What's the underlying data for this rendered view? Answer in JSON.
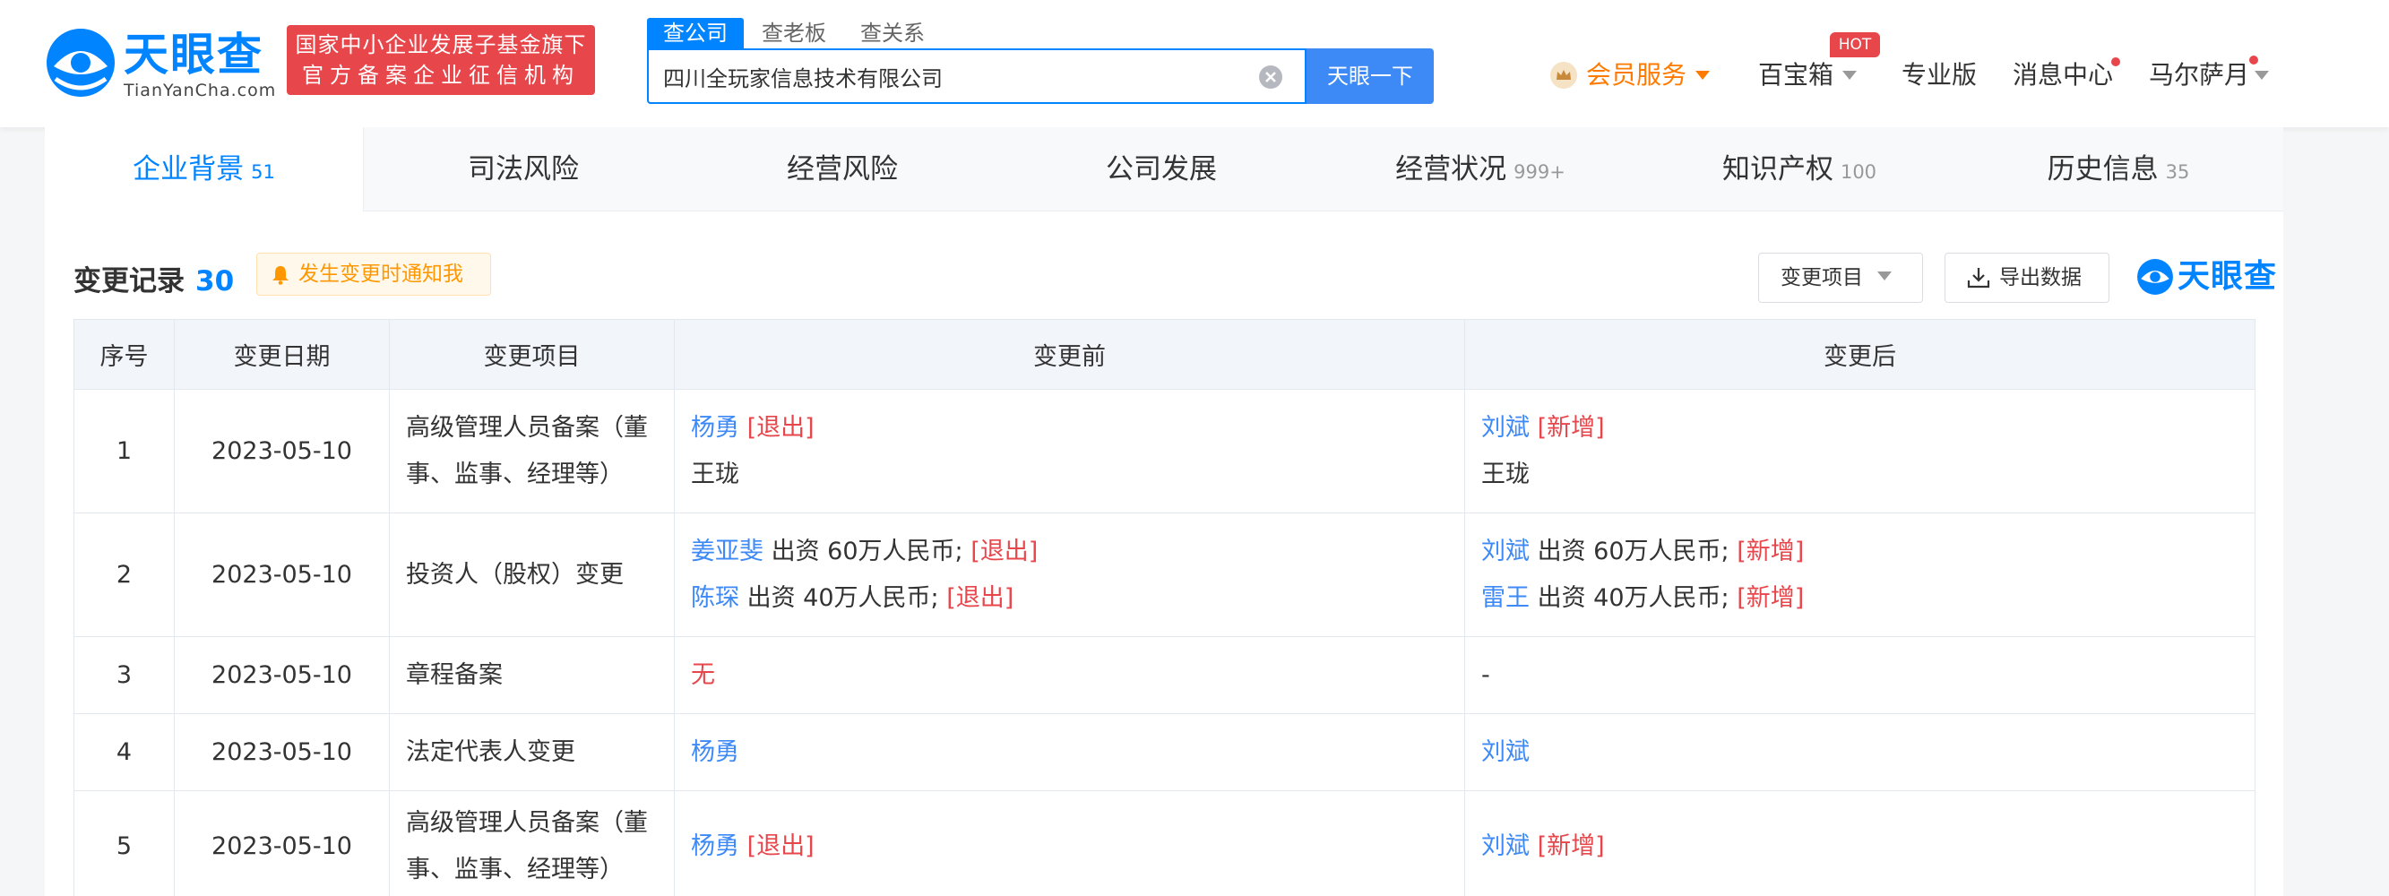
{
  "header": {
    "logo_text": "天眼查",
    "logo_sub": "TianYanCha.com",
    "badge_line1": "国家中小企业发展子基金旗下",
    "badge_line2": "官方备案企业征信机构",
    "search_tabs": [
      "查公司",
      "查老板",
      "查关系"
    ],
    "search_value": "四川全玩家信息技术有限公司",
    "search_button": "天眼一下",
    "nav": {
      "vip": "会员服务",
      "toolbox": "百宝箱",
      "hot": "HOT",
      "pro": "专业版",
      "messages": "消息中心",
      "user": "马尔萨月"
    }
  },
  "tabs": [
    {
      "label": "企业背景",
      "count": "51"
    },
    {
      "label": "司法风险",
      "count": ""
    },
    {
      "label": "经营风险",
      "count": ""
    },
    {
      "label": "公司发展",
      "count": ""
    },
    {
      "label": "经营状况",
      "count": "999+"
    },
    {
      "label": "知识产权",
      "count": "100"
    },
    {
      "label": "历史信息",
      "count": "35"
    }
  ],
  "section": {
    "title": "变更记录",
    "count": "30",
    "notify": "发生变更时通知我",
    "filter": "变更项目",
    "export": "导出数据",
    "mini_logo": "天眼查"
  },
  "table": {
    "headers": [
      "序号",
      "变更日期",
      "变更项目",
      "变更前",
      "变更后"
    ],
    "rows": [
      {
        "idx": "1",
        "date": "2023-05-10",
        "item": "高级管理人员备案（董事、监事、经理等）",
        "before": [
          {
            "name": "杨勇",
            "text": "",
            "tag": "[退出]"
          },
          {
            "name": "",
            "text": "王珑",
            "tag": ""
          }
        ],
        "after": [
          {
            "name": "刘斌",
            "text": "",
            "tag": "[新增]"
          },
          {
            "name": "",
            "text": "王珑",
            "tag": ""
          }
        ]
      },
      {
        "idx": "2",
        "date": "2023-05-10",
        "item": "投资人（股权）变更",
        "before": [
          {
            "name": "姜亚斐",
            "text": "出资 60万人民币;",
            "tag": "[退出]"
          },
          {
            "name": "陈琛",
            "text": "出资 40万人民币;",
            "tag": "[退出]"
          }
        ],
        "after": [
          {
            "name": "刘斌",
            "text": "出资 60万人民币;",
            "tag": "[新增]"
          },
          {
            "name": "雷王",
            "text": "出资 40万人民币;",
            "tag": "[新增]"
          }
        ]
      },
      {
        "idx": "3",
        "date": "2023-05-10",
        "item": "章程备案",
        "before": [
          {
            "name": "",
            "text": "",
            "tag": "",
            "none": "无"
          }
        ],
        "after": [
          {
            "name": "",
            "text": "-",
            "tag": ""
          }
        ]
      },
      {
        "idx": "4",
        "date": "2023-05-10",
        "item": "法定代表人变更",
        "before": [
          {
            "name": "杨勇",
            "text": "",
            "tag": ""
          }
        ],
        "after": [
          {
            "name": "刘斌",
            "text": "",
            "tag": ""
          }
        ]
      },
      {
        "idx": "5",
        "date": "2023-05-10",
        "item": "高级管理人员备案（董事、监事、经理等）",
        "before": [
          {
            "name": "杨勇",
            "text": "",
            "tag": "[退出]"
          }
        ],
        "after": [
          {
            "name": "刘斌",
            "text": "",
            "tag": "[新增]"
          }
        ]
      }
    ]
  },
  "colors": {
    "brand_blue": "#0084ff",
    "button_blue": "#3d8af7",
    "badge_red": "#e7464b",
    "vip_orange": "#ff7a00"
  }
}
